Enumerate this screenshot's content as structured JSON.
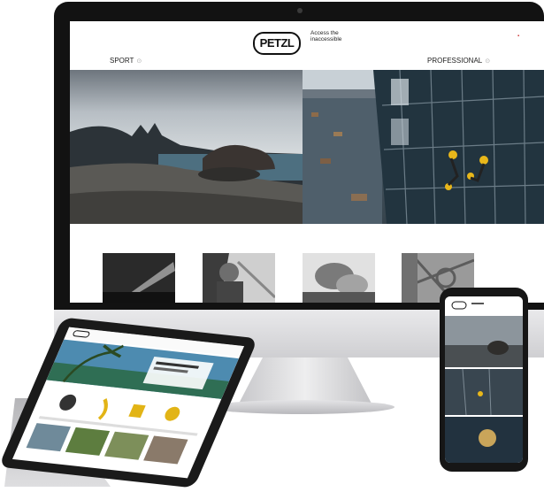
{
  "site": {
    "logo": "PETZL",
    "tagline": "Access the inaccessible",
    "language_flag": "▪",
    "nav_sport": "SPORT",
    "nav_professional": "PROFESSIONAL",
    "nav_arrow": "⊙"
  },
  "colors": {
    "device_black": "#121212",
    "device_silver": "#d6d6d8",
    "climber_yellow": "#e8b71a"
  }
}
